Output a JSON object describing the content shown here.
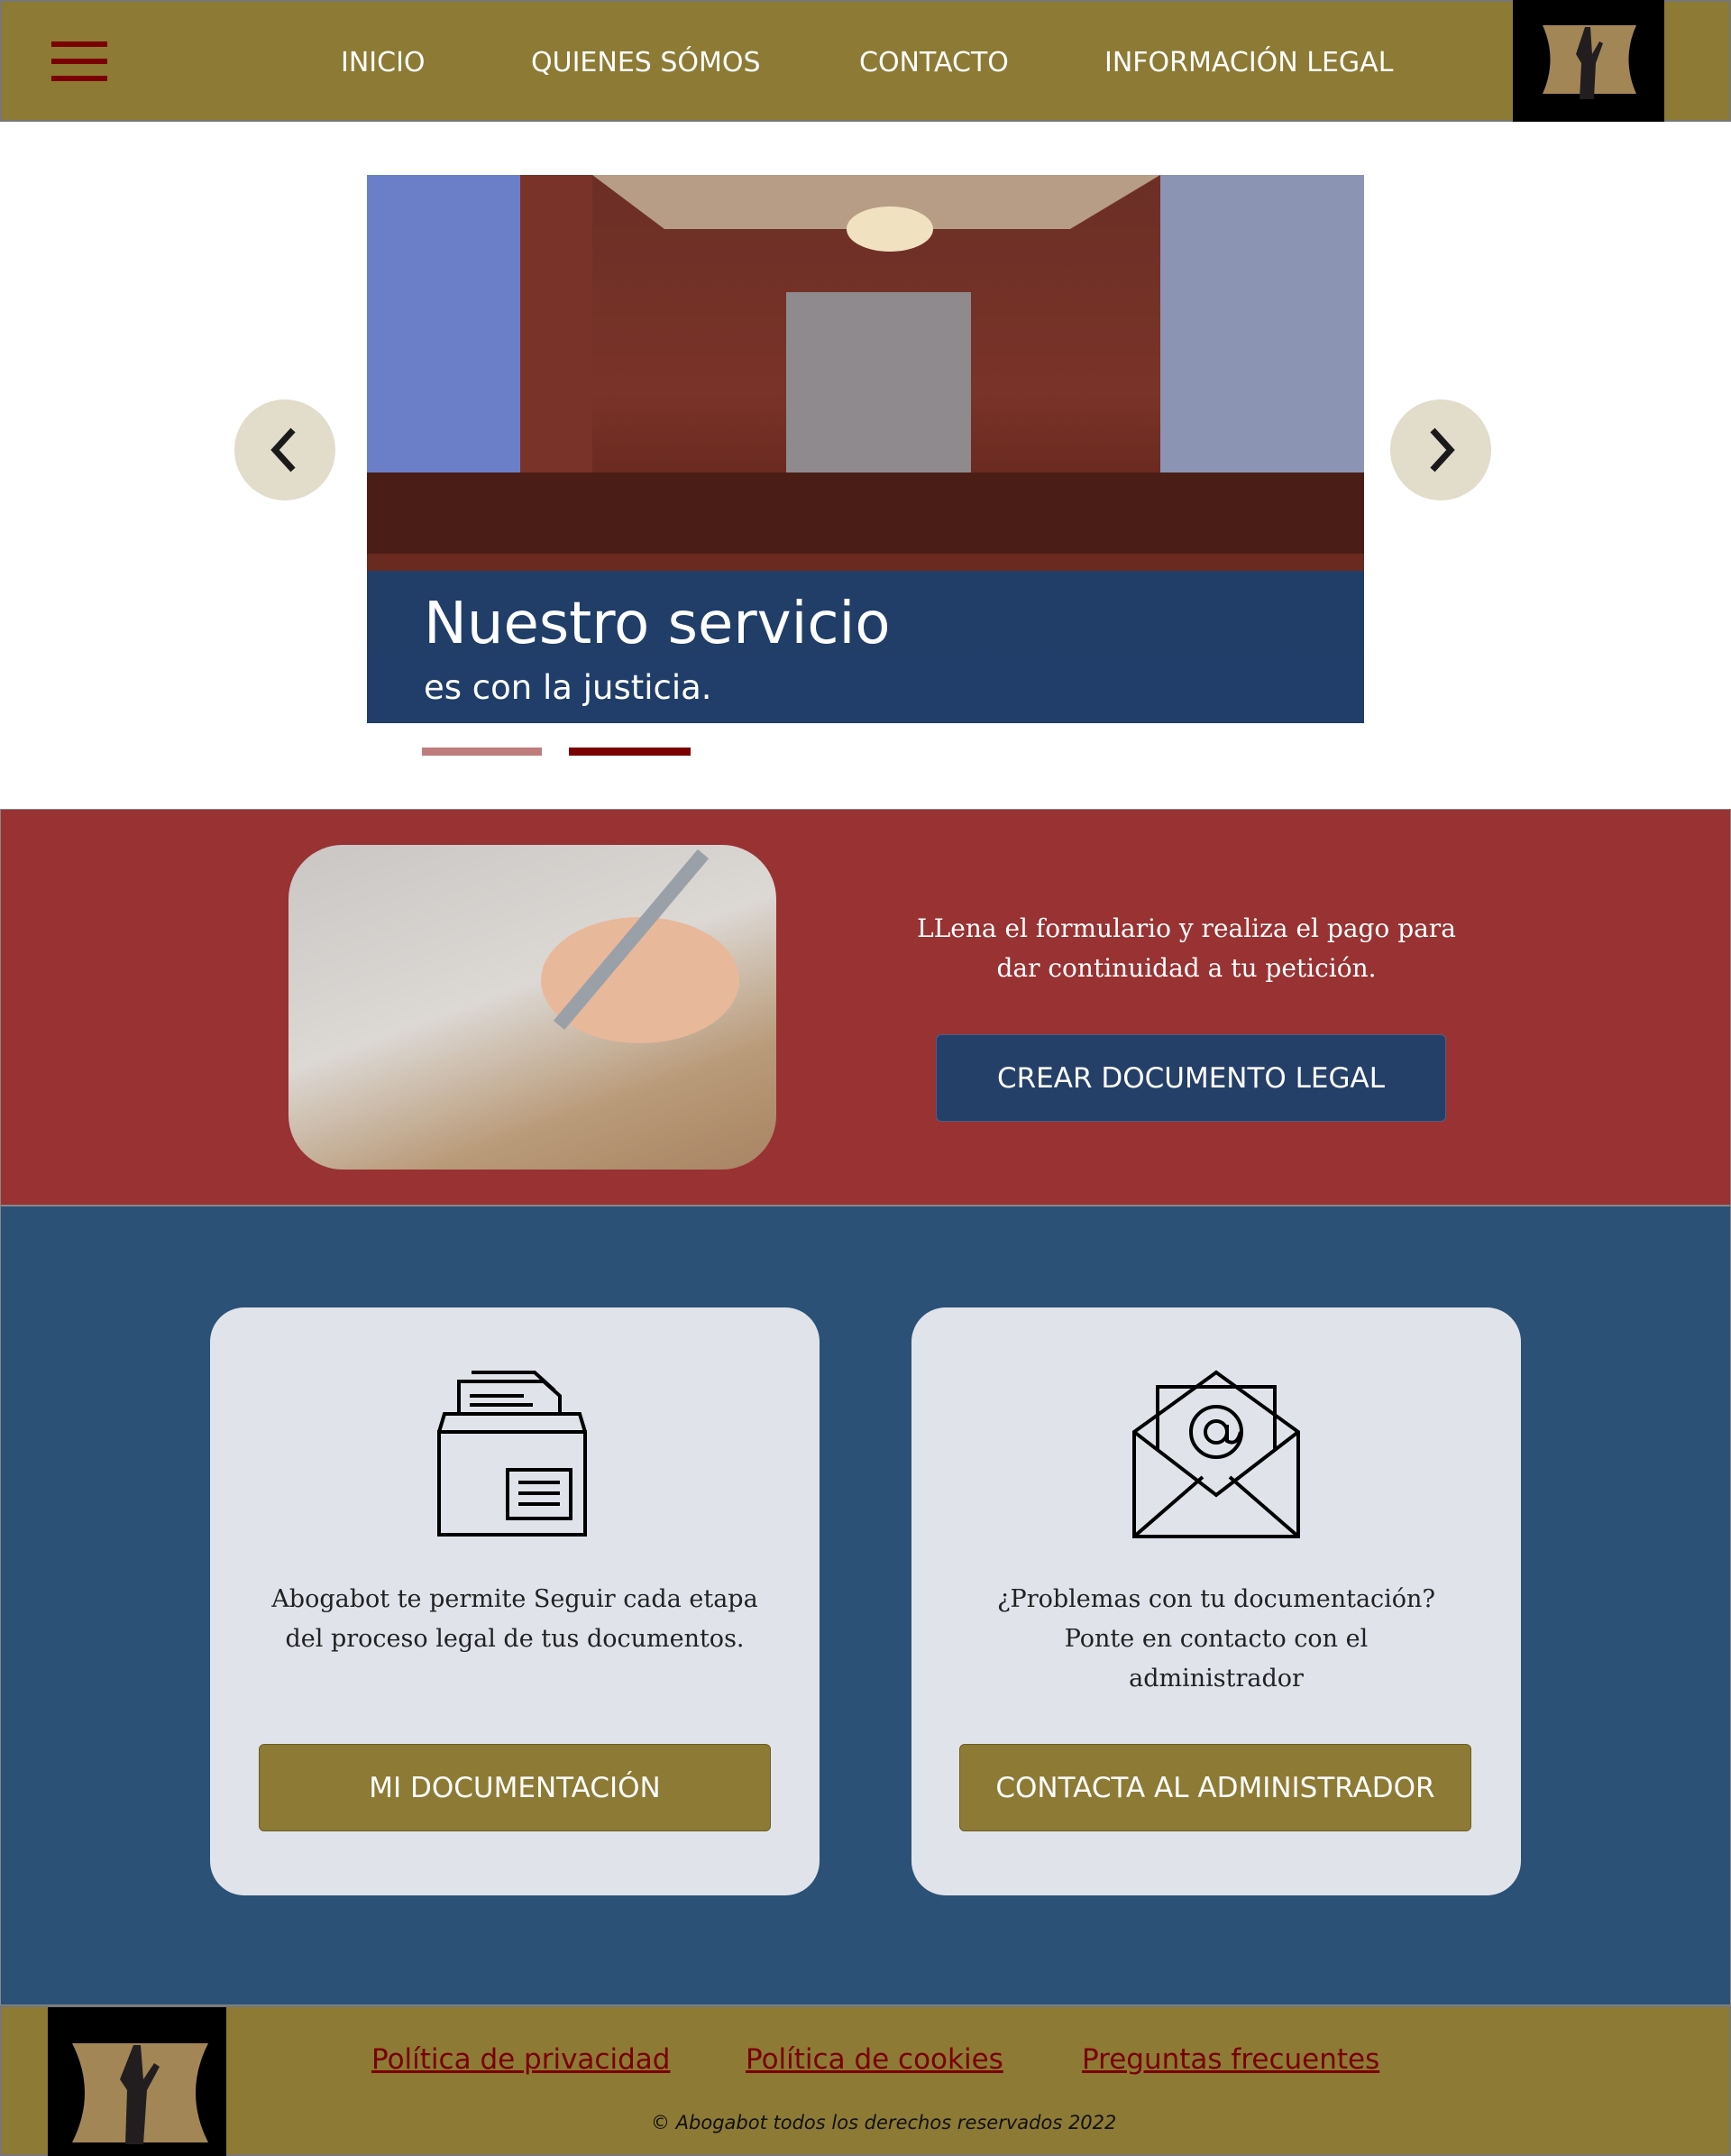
{
  "header": {
    "nav": [
      "INICIO",
      "QUIENES SÓMOS",
      "CONTACTO",
      "INFORMACIÓN LEGAL"
    ]
  },
  "carousel": {
    "title": "Nuestro servicio",
    "subtitle": "es con la justicia.",
    "slides": 2,
    "active_slide": 2
  },
  "cta": {
    "text_line1": "LLena el formulario y realiza el pago para",
    "text_line2": "dar continuidad a tu petición.",
    "button": "CREAR DOCUMENTO LEGAL"
  },
  "cards": [
    {
      "lines": [
        "Abogabot te permite Seguir cada etapa",
        "del proceso legal de tus documentos."
      ],
      "button": "MI DOCUMENTACIÓN"
    },
    {
      "lines": [
        "¿Problemas con tu documentación?",
        "Ponte en contacto con el",
        "administrador"
      ],
      "button": "CONTACTA AL ADMINISTRADOR"
    }
  ],
  "footer": {
    "links": [
      "Política de privacidad",
      "Política de cookies",
      "Preguntas frecuentes"
    ],
    "copyright": "© Abogabot todos los derechos reservados 2022"
  },
  "colors": {
    "gold": "#8d7a35",
    "red": "#993233",
    "navy": "#2b5177",
    "button_navy": "#243f68",
    "link": "#7a0000"
  }
}
